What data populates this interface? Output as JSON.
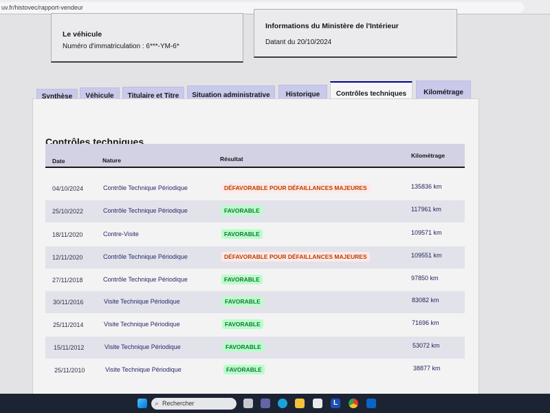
{
  "browser": {
    "url": "uv.fr/histovec/rapport-vendeur"
  },
  "vehicle_card": {
    "title": "Le véhicule",
    "registration": "Numéro d'immatriculation : 6***-YM-6*"
  },
  "ministry_card": {
    "title": "Informations du Ministère de l'Intérieur",
    "date": "Datant du 20/10/2024"
  },
  "tabs": [
    {
      "label": "Synthèse"
    },
    {
      "label": "Véhicule"
    },
    {
      "label": "Titulaire et Titre"
    },
    {
      "label": "Situation administrative"
    },
    {
      "label": "Historique"
    },
    {
      "label": "Contrôles techniques"
    },
    {
      "label": "Kilométrage"
    }
  ],
  "active_tab": "Contrôles techniques",
  "section": {
    "title": "Contrôles techniques",
    "columns": {
      "date": "Date",
      "nature": "Nature",
      "result": "Résultat",
      "km": "Kilométrage"
    }
  },
  "rows": [
    {
      "date": "04/10/2024",
      "nature": "Contrôle Technique Périodique",
      "result": "DÉFAVORABLE POUR DÉFAILLANCES MAJEURES",
      "km": "135836 km"
    },
    {
      "date": "25/10/2022",
      "nature": "Contrôle Technique Périodique",
      "result": "FAVORABLE",
      "km": "117961 km"
    },
    {
      "date": "18/11/2020",
      "nature": "Contre-Visite",
      "result": "FAVORABLE",
      "km": "109571 km"
    },
    {
      "date": "12/11/2020",
      "nature": "Contrôle Technique Périodique",
      "result": "DÉFAVORABLE POUR DÉFAILLANCES MAJEURES",
      "km": "109551 km"
    },
    {
      "date": "27/11/2018",
      "nature": "Contrôle Technique Périodique",
      "result": "FAVORABLE",
      "km": "97850 km"
    },
    {
      "date": "30/11/2016",
      "nature": "Visite Technique Périodique",
      "result": "FAVORABLE",
      "km": "83082 km"
    },
    {
      "date": "25/11/2014",
      "nature": "Visite Technique Périodique",
      "result": "FAVORABLE",
      "km": "71696 km"
    },
    {
      "date": "15/11/2012",
      "nature": "Visite Technique Périodique",
      "result": "FAVORABLE",
      "km": "53072 km"
    },
    {
      "date": "25/11/2010",
      "nature": "Visite Technique Périodique",
      "result": "FAVORABLE",
      "km": "38877 km"
    }
  ],
  "colors": {
    "favorable_bg": "#b8fec9",
    "favorable_text": "#18753c",
    "defavorable_bg": "#ffe9e6",
    "defavorable_text": "#b34000",
    "accent": "#000091"
  },
  "taskbar": {
    "search_placeholder": "Rechercher",
    "icons": [
      "windows-start-icon",
      "search-icon",
      "file-explorer-icon",
      "teams-icon",
      "edge-icon",
      "folder-icon",
      "store-icon",
      "word-l-icon",
      "chrome-icon",
      "outlook-icon"
    ]
  }
}
